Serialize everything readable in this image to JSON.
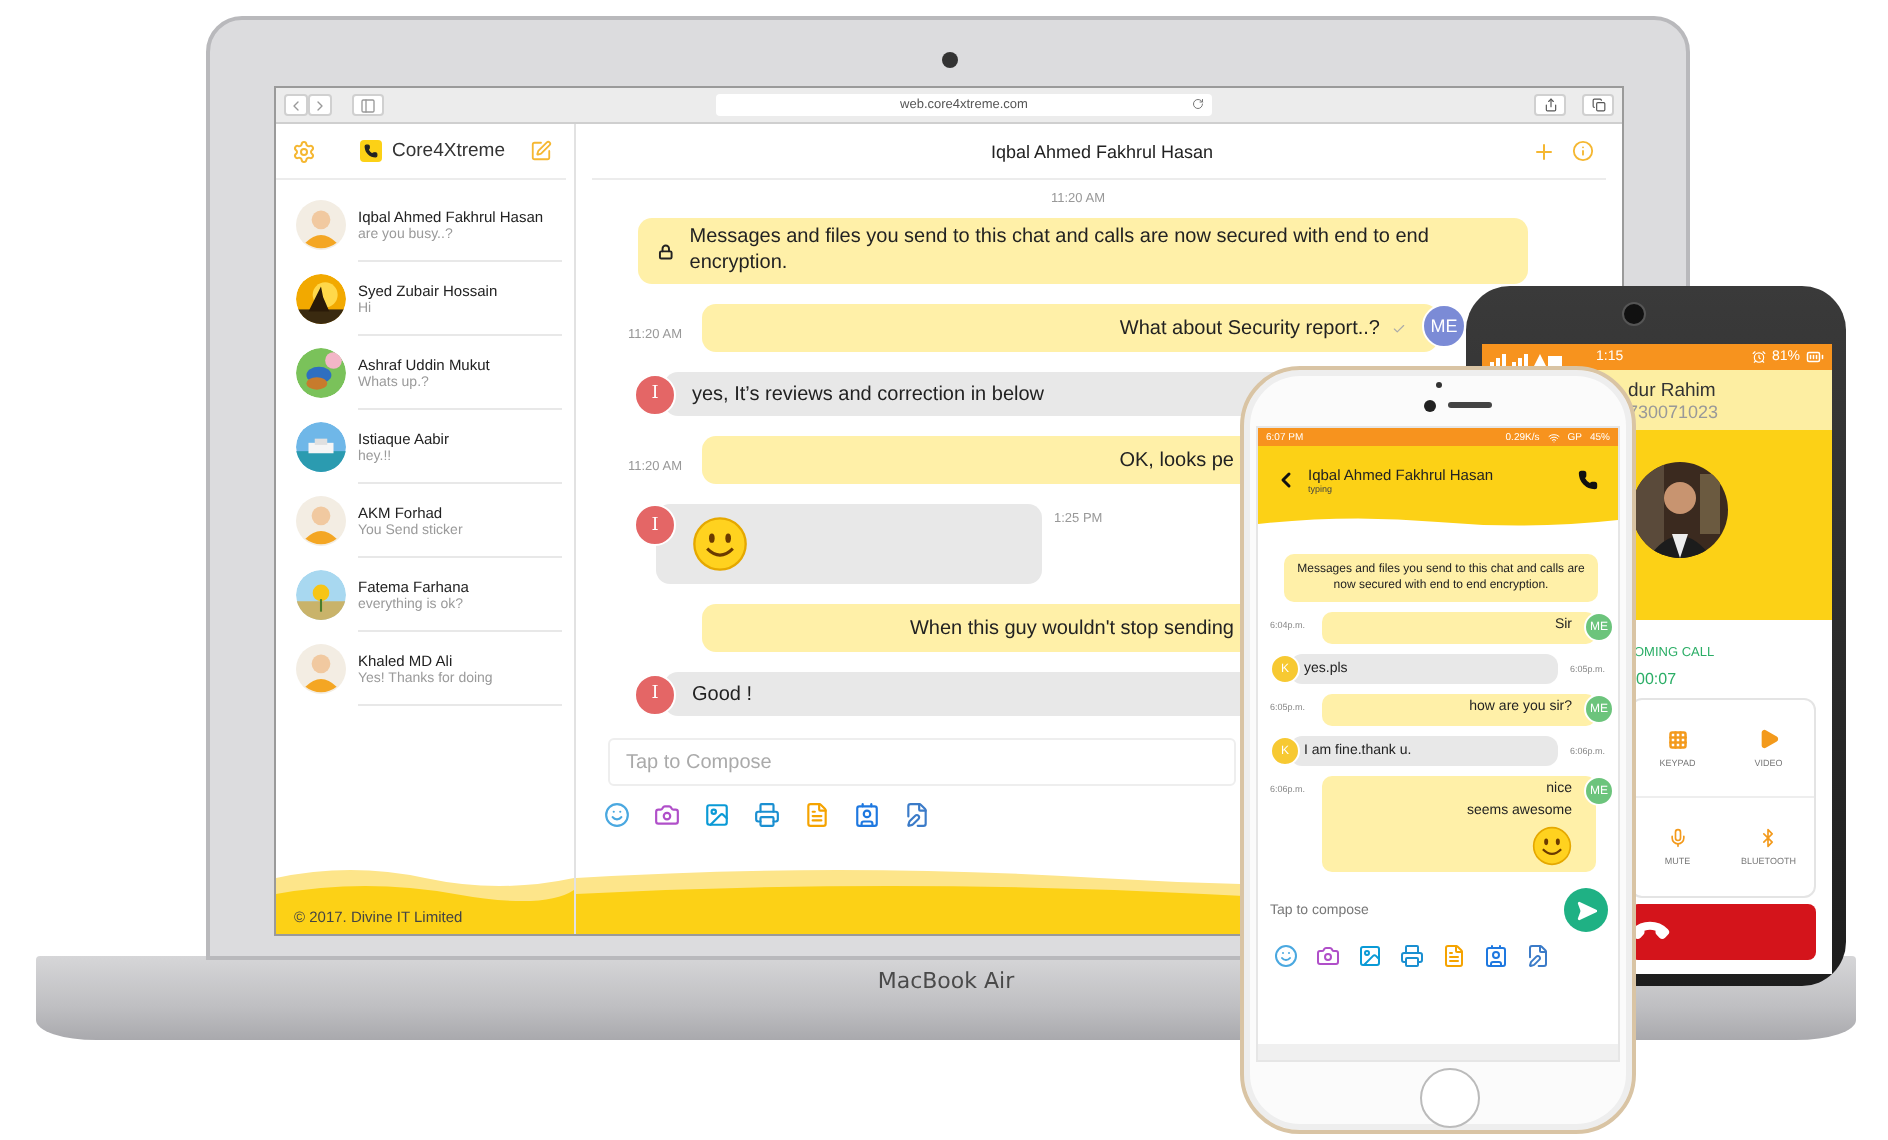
{
  "browser": {
    "url": "web.core4xtreme.com"
  },
  "sidebar": {
    "app_name": "Core4Xtreme",
    "contacts": [
      {
        "name": "Iqbal Ahmed Fakhrul Hasan",
        "preview": "are you busy..?",
        "kind": "person"
      },
      {
        "name": "Syed Zubair Hossain",
        "preview": "Hi",
        "kind": "picture"
      },
      {
        "name": "Ashraf Uddin Mukut",
        "preview": "Whats up.?",
        "kind": "picture"
      },
      {
        "name": "Istiaque Aabir",
        "preview": "hey.!!",
        "kind": "picture"
      },
      {
        "name": "AKM Forhad",
        "preview": "You Send sticker",
        "kind": "person"
      },
      {
        "name": "Fatema Farhana",
        "preview": "everything is ok?",
        "kind": "picture"
      },
      {
        "name": "Khaled MD Ali",
        "preview": "Yes! Thanks for doing",
        "kind": "person"
      }
    ],
    "footer": "© 2017. Divine IT Limited"
  },
  "chat": {
    "title": "Iqbal Ahmed Fakhrul Hasan",
    "messages": [
      {
        "kind": "notice",
        "time": "11:20 AM",
        "text": "Messages and files you send to this chat and calls are now secured with end to end encryption."
      },
      {
        "kind": "out",
        "time": "11:20 AM",
        "avatar": "ME",
        "text": "What about Security report..?"
      },
      {
        "kind": "in",
        "avatar": "I",
        "text": "yes, It’s reviews and correction in below"
      },
      {
        "kind": "out",
        "time": "11:20 AM",
        "text": "OK, looks pe"
      },
      {
        "kind": "sticker",
        "avatar": "I",
        "time": "1:25 PM"
      },
      {
        "kind": "out",
        "text": "When this guy wouldn't stop sending"
      },
      {
        "kind": "in",
        "avatar": "I",
        "text": "Good !"
      }
    ],
    "compose": {
      "placeholder": "Tap to Compose"
    }
  },
  "laptop": {
    "label": "MacBook Air"
  },
  "android": {
    "status_time": "1:15",
    "battery": "81%",
    "caller_name": "dur Rahim",
    "caller_number": "730071023",
    "call_status": "OMING CALL",
    "duration": "00:07",
    "actions": [
      {
        "kind": "keypad",
        "label": "KEYPAD"
      },
      {
        "kind": "video",
        "label": "VIDEO"
      },
      {
        "kind": "mute",
        "label": "MUTE"
      },
      {
        "kind": "bluetooth",
        "label": "BLUETOOTH"
      }
    ]
  },
  "iphone": {
    "status_time": "6:07 PM",
    "speed": "0.29K/s",
    "carrier": "GP",
    "battery": "45%",
    "title": "Iqbal Ahmed Fakhrul Hasan",
    "subtitle": "typing",
    "notice": "Messages and files you send to this chat and calls are now secured with end to end encryption.",
    "messages": [
      {
        "kind": "out",
        "time": "6:04p.m.",
        "avatar": "ME",
        "lines": [
          "Sir"
        ],
        "sticker": false
      },
      {
        "kind": "in",
        "avatar": "K",
        "text": "yes.pls",
        "time": "6:05p.m."
      },
      {
        "kind": "out",
        "time": "6:05p.m.",
        "avatar": "ME",
        "lines": [
          "how are you sir?"
        ],
        "sticker": false
      },
      {
        "kind": "in",
        "avatar": "K",
        "text": "I am fine.thank u.",
        "time": "6:06p.m."
      },
      {
        "kind": "out",
        "time": "6:06p.m.",
        "avatar": "ME",
        "lines": [
          "nice",
          "seems awesome"
        ],
        "sticker": true
      }
    ],
    "compose": {
      "placeholder": "Tap to compose"
    }
  }
}
